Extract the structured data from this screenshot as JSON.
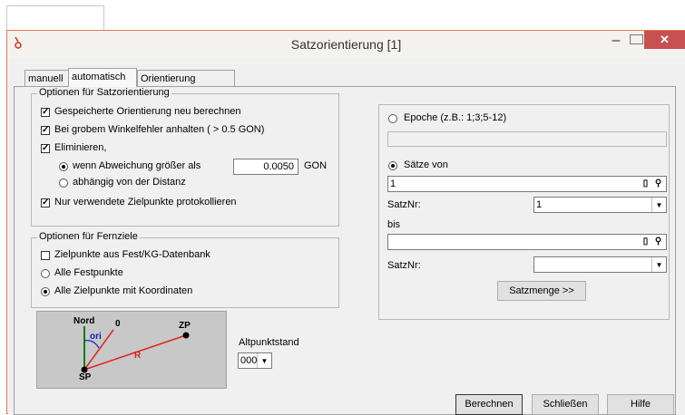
{
  "window": {
    "title": "Satzorientierung [1]"
  },
  "icons": {
    "app": "app-icon",
    "minimize": "minimize-icon",
    "maximize": "maximize-icon",
    "close": "close-icon",
    "select": "select-icon",
    "pick": "pick-icon"
  },
  "tabs": [
    {
      "label": "manuell",
      "active": false
    },
    {
      "label": "automatisch",
      "active": true
    },
    {
      "label": "Orientierung löschen",
      "active": false
    }
  ],
  "options_orientation": {
    "title": "Optionen für Satzorientierung",
    "items": [
      {
        "label": "Gespeicherte Orientierung neu berechnen",
        "checked": true
      },
      {
        "label": "Bei grobem Winkelfehler anhalten ( > 0.5 GON)",
        "checked": true
      },
      {
        "label": "Eliminieren,",
        "checked": true
      }
    ],
    "radio_deviation": "wenn Abweichung größer als",
    "radio_distance": "abhängig von der Distanz",
    "threshold_value": "0.0050",
    "threshold_unit": "GON",
    "log_only_used": "Nur verwendete Zielpunkte protokollieren"
  },
  "options_far": {
    "title": "Optionen für Fernziele",
    "db_targets": "Zielpunkte aus Fest/KG-Datenbank",
    "all_fixed": "Alle Festpunkte",
    "all_coords": "Alle Zielpunkte mit Koordinaten"
  },
  "diagram": {
    "north": "Nord",
    "zero": "0",
    "ori": "ori",
    "r": "R",
    "sp": "SP",
    "zp": "ZP"
  },
  "altpunkt": {
    "label": "Altpunktstand",
    "value": "000"
  },
  "right": {
    "epoch_label": "Epoche (z.B.: 1;3;5-12)",
    "epoch_value": "",
    "saetze_label": "Sätze von",
    "from_value": "1",
    "satznr_label": "SatzNr:",
    "satznr_from": "1",
    "bis_label": "bis",
    "to_value": "",
    "satznr_to": "",
    "satzmenge_label": "Satzmenge >>"
  },
  "buttons": {
    "compute": "Berechnen",
    "close": "Schließen",
    "help": "Hilfe"
  },
  "colors": {
    "close_button": "#c75050",
    "border_accent": "#e2774e",
    "diagram_line": "#e02020",
    "north_line": "#108010",
    "ori_text": "#1020c0"
  }
}
